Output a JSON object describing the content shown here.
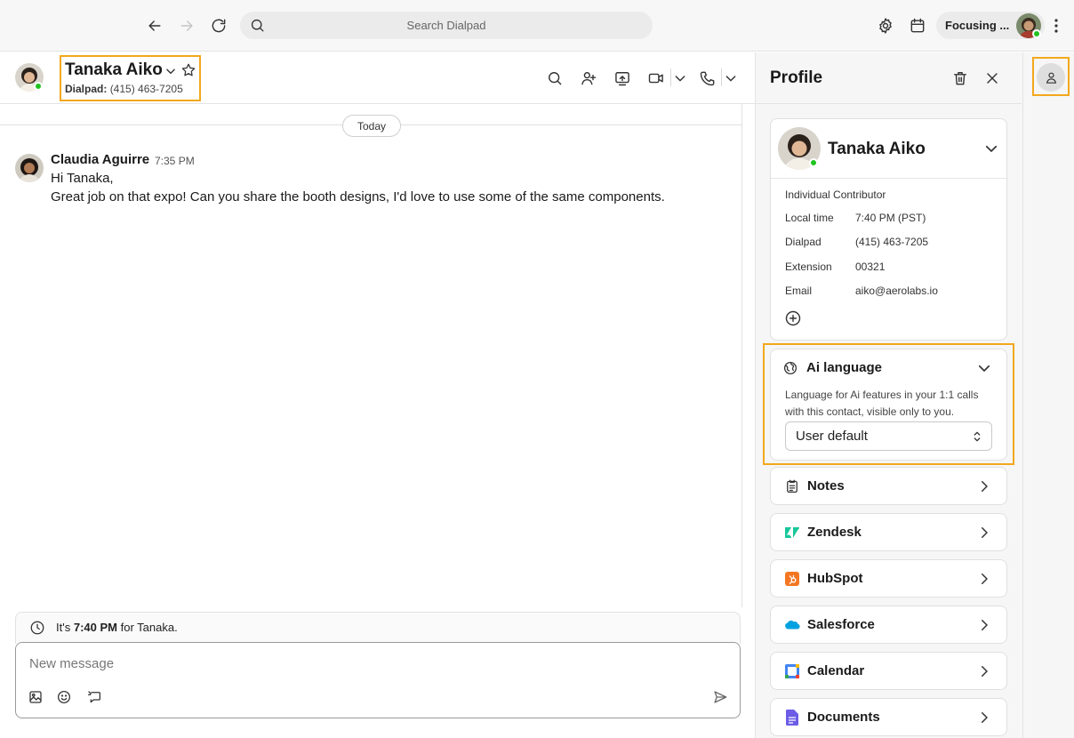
{
  "topbar": {
    "search_placeholder": "Search Dialpad",
    "status_label": "Focusing ..."
  },
  "chat": {
    "contact_name": "Tanaka Aiko",
    "contact_sub_label": "Dialpad:",
    "contact_sub_value": "(415) 463-7205",
    "day_divider": "Today",
    "message": {
      "author": "Claudia Aguirre",
      "time": "7:35 PM",
      "line1": "Hi Tanaka,",
      "line2": "Great job on that expo! Can you share the booth designs, I'd love to use some of the same components."
    },
    "local_time_pre": "It's",
    "local_time_value": "7:40 PM",
    "local_time_post": "for Tanaka.",
    "composer_placeholder": "New message"
  },
  "profile": {
    "title": "Profile",
    "card": {
      "name": "Tanaka Aiko",
      "role": "Individual Contributor",
      "fields": [
        {
          "label": "Local time",
          "value": "7:40 PM (PST)"
        },
        {
          "label": "Dialpad",
          "value": "(415) 463-7205"
        },
        {
          "label": "Extension",
          "value": "00321"
        },
        {
          "label": "Email",
          "value": "aiko@aerolabs.io"
        }
      ]
    },
    "ai_language": {
      "title": "Ai language",
      "desc_line1": "Language for Ai features in your 1:1 calls",
      "desc_line2": "with this contact, visible only to you.",
      "selected": "User default"
    },
    "integrations": [
      {
        "label": "Notes",
        "icon": "notes-icon"
      },
      {
        "label": "Zendesk",
        "icon": "zendesk-icon"
      },
      {
        "label": "HubSpot",
        "icon": "hubspot-icon"
      },
      {
        "label": "Salesforce",
        "icon": "salesforce-icon"
      },
      {
        "label": "Calendar",
        "icon": "calendar-icon"
      },
      {
        "label": "Documents",
        "icon": "documents-icon"
      }
    ]
  },
  "colors": {
    "highlight": "#f2a81d",
    "presence": "#1ec41e",
    "zendesk": "#03363d",
    "hubspot": "#ff7a59",
    "salesforce": "#00a1e0",
    "documents": "#6c5ce7"
  }
}
